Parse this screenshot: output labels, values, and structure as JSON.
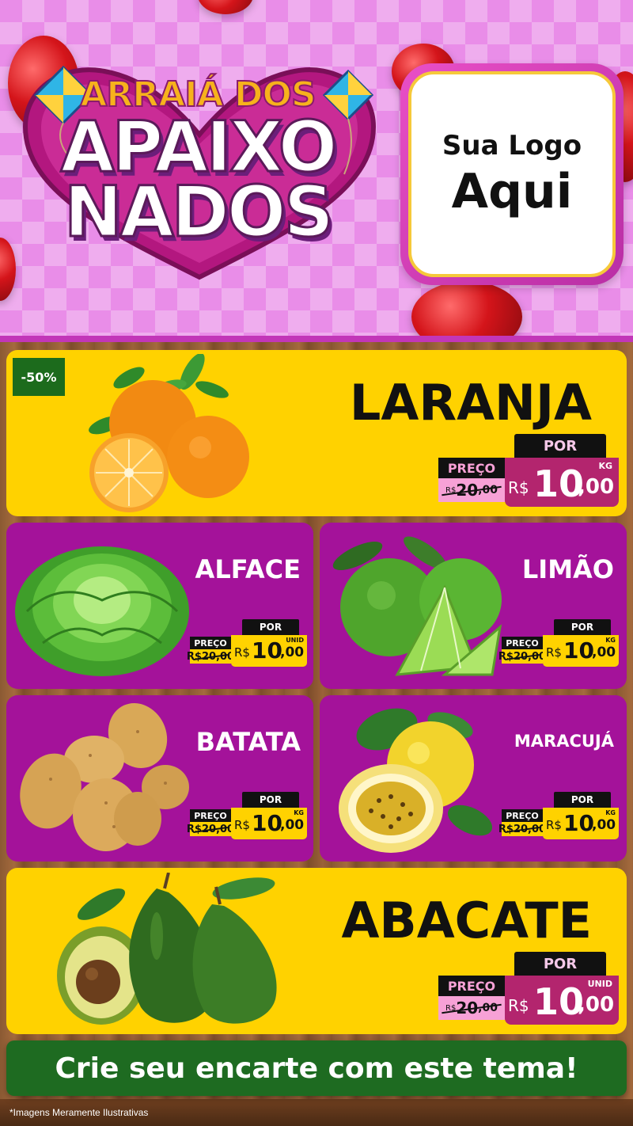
{
  "header": {
    "title_line1": "ARRAIÁ DOS",
    "title_line2": "APAIXO",
    "title_line3": "NADOS",
    "logo_line1": "Sua Logo",
    "logo_line2": "Aqui"
  },
  "products": {
    "laranja": {
      "name": "LARANJA",
      "badge": "-50%",
      "por": "POR",
      "preco": "PREÇO",
      "old_currency": "R$",
      "old_int": "20",
      "old_dec": ",00",
      "currency": "R$",
      "int": "10",
      "dec": ",00",
      "unit": "KG"
    },
    "alface": {
      "name": "ALFACE",
      "por": "POR",
      "preco": "PREÇO",
      "old_price": "R$20,00",
      "currency": "R$",
      "int": "10",
      "dec": ",00",
      "unit": "UNID"
    },
    "limao": {
      "name": "LIMÃO",
      "por": "POR",
      "preco": "PREÇO",
      "old_price": "R$20,00",
      "currency": "R$",
      "int": "10",
      "dec": ",00",
      "unit": "KG"
    },
    "batata": {
      "name": "BATATA",
      "por": "POR",
      "preco": "PREÇO",
      "old_price": "R$20,00",
      "currency": "R$",
      "int": "10",
      "dec": ",00",
      "unit": "KG"
    },
    "maracuja": {
      "name": "MARACUJÁ",
      "por": "POR",
      "preco": "PREÇO",
      "old_price": "R$20,00",
      "currency": "R$",
      "int": "10",
      "dec": ",00",
      "unit": "KG"
    },
    "abacate": {
      "name": "ABACATE",
      "por": "POR",
      "preco": "PREÇO",
      "old_currency": "R$",
      "old_int": "20",
      "old_dec": ",00",
      "currency": "R$",
      "int": "10",
      "dec": ",00",
      "unit": "UNID"
    }
  },
  "cta": {
    "label": "Crie seu encarte com este tema!"
  },
  "footer": {
    "disclaimer": "*Imagens Meramente Ilustrativas"
  },
  "colors": {
    "header_pink": "#e98de8",
    "card_yellow": "#ffd200",
    "card_purple": "#a4129a",
    "price_magenta": "#b3256e",
    "cta_green": "#1e6b21"
  },
  "icons": [
    "orange-image",
    "lettuce-image",
    "lime-image",
    "potato-image",
    "passion-fruit-image",
    "avocado-image",
    "kite-icon",
    "heart-balloon-icon"
  ]
}
